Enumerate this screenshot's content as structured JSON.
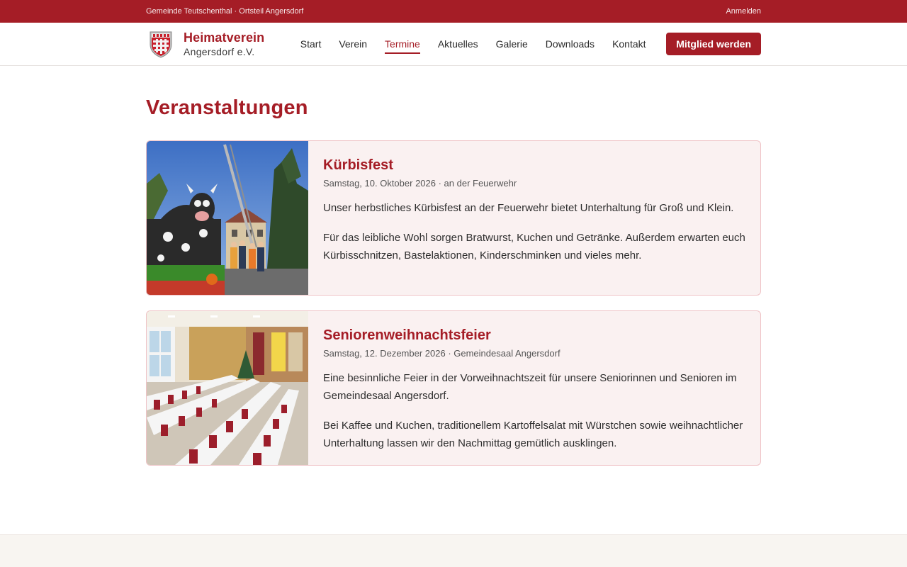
{
  "topbar": {
    "location": "Gemeinde Teutschenthal · Ortsteil Angersdorf",
    "login": "Anmelden"
  },
  "brand": {
    "title": "Heimatverein",
    "subtitle": "Angersdorf e.V.",
    "crest_color": "#a51d26"
  },
  "nav": {
    "items": [
      {
        "label": "Start"
      },
      {
        "label": "Verein"
      },
      {
        "label": "Termine",
        "active": true
      },
      {
        "label": "Aktuelles"
      },
      {
        "label": "Galerie"
      },
      {
        "label": "Downloads"
      },
      {
        "label": "Kontakt"
      }
    ],
    "cta": "Mitglied werden"
  },
  "page": {
    "title": "Veranstaltungen"
  },
  "events": [
    {
      "title": "Kürbisfest",
      "meta": "Samstag, 10. Oktober 2026 · an der Feuerwehr",
      "text1": "Unser herbstliches Kürbisfest an der Feuerwehr bietet Unterhaltung für Groß und Klein.",
      "text2": "Für das leibliche Wohl sorgen Bratwurst, Kuchen und Getränke. Außerdem erwarten euch Kürbisschnitzen, Bastelaktionen, Kinderschminken und vieles mehr."
    },
    {
      "title": "Seniorenweihnachtsfeier",
      "meta": "Samstag, 12. Dezember 2026 · Gemeindesaal Angersdorf",
      "text1": "Eine besinnliche Feier in der Vorweihnachtszeit für unsere Seniorinnen und Senioren im Gemeindesaal Angersdorf.",
      "text2": "Bei Kaffee und Kuchen, traditionellem Kartoffelsalat mit Würstchen sowie weihnachtlicher Unterhaltung lassen wir den Nachmittag gemütlich ausklingen."
    }
  ],
  "colors": {
    "accent": "#a51d26",
    "card_bg": "#faf1f1",
    "card_border": "#efc3c6",
    "footer_bg": "#f8f5f1"
  }
}
